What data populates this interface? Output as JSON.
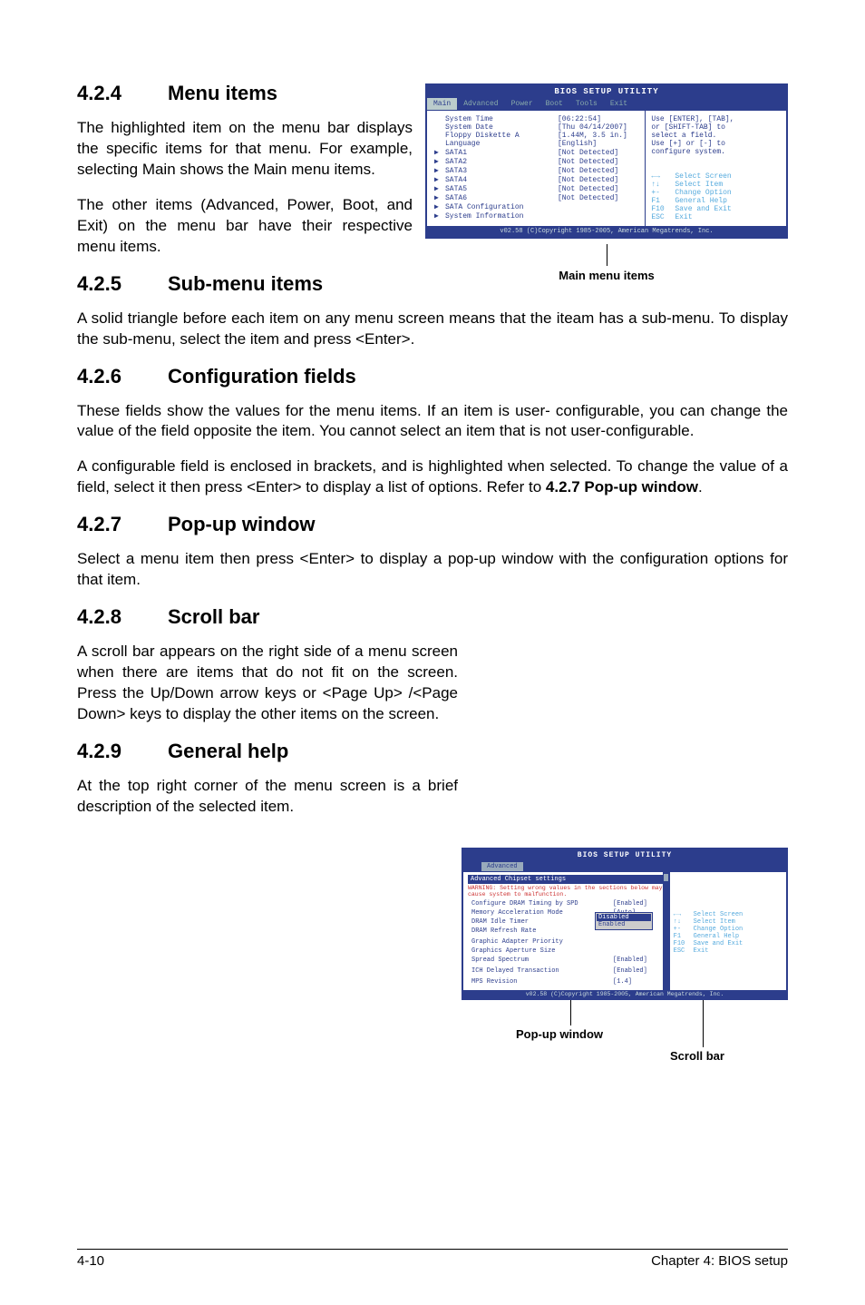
{
  "sections": {
    "s424": {
      "num": "4.2.4",
      "title": "Menu items",
      "p1": "The highlighted item on the menu bar displays the specific items for that menu. For example, selecting Main shows the Main menu items.",
      "p2": "The other items (Advanced, Power, Boot, and Exit) on the menu bar have their respective menu items."
    },
    "s425": {
      "num": "4.2.5",
      "title": "Sub-menu items",
      "p1": "A solid triangle before each item on any menu screen means that the iteam has a sub-menu. To display the sub-menu, select the item and press <Enter>."
    },
    "s426": {
      "num": "4.2.6",
      "title": "Configuration fields",
      "p1": "These fields show the values for the menu items. If an item is user- configurable, you can change the value of the field opposite the item. You cannot select an item that is not user-configurable.",
      "p2": "A configurable field is enclosed in brackets, and is highlighted when selected. To change the value of a field, select it then press <Enter> to display a list of options. Refer to ",
      "bold": "4.2.7 Pop-up window",
      "p2b": "."
    },
    "s427": {
      "num": "4.2.7",
      "title": "Pop-up window",
      "p1": "Select a menu item then press <Enter> to display a pop-up window with the configuration options for that item."
    },
    "s428": {
      "num": "4.2.8",
      "title": "Scroll bar",
      "p1": "A scroll bar appears on the right side of a menu screen when there are items that do not fit on the screen. Press the Up/Down arrow keys or <Page Up> /<Page Down> keys to display the other items on the screen."
    },
    "s429": {
      "num": "4.2.9",
      "title": "General help",
      "p1": "At the top right corner of the menu screen is a brief description of the selected item."
    }
  },
  "fig1": {
    "setup_title": "BIOS SETUP UTILITY",
    "tabs": [
      "Main",
      "Advanced",
      "Power",
      "Boot",
      "Tools",
      "Exit"
    ],
    "rows": [
      [
        "",
        "System Time",
        "[06:22:54]"
      ],
      [
        "",
        "System Date",
        "[Thu 04/14/2007]"
      ],
      [
        "",
        "Floppy Diskette A",
        "[1.44M, 3.5 in.]"
      ],
      [
        "",
        "Language",
        "[English]"
      ],
      [
        "",
        "",
        ""
      ],
      [
        "▶",
        "SATA1",
        "[Not Detected]"
      ],
      [
        "▶",
        "SATA2",
        "[Not Detected]"
      ],
      [
        "▶",
        "SATA3",
        "[Not Detected]"
      ],
      [
        "▶",
        "SATA4",
        "[Not Detected]"
      ],
      [
        "▶",
        "SATA5",
        "[Not Detected]"
      ],
      [
        "▶",
        "SATA6",
        "[Not Detected]"
      ],
      [
        "",
        "",
        ""
      ],
      [
        "▶",
        "SATA Configuration",
        ""
      ],
      [
        "▶",
        "System Information",
        ""
      ]
    ],
    "help": [
      "Use [ENTER], [TAB],",
      "or [SHIFT-TAB] to",
      "select a field.",
      "",
      "Use [+] or [-] to",
      "configure system."
    ],
    "nav": [
      [
        "←→",
        "Select Screen"
      ],
      [
        "↑↓",
        "Select Item"
      ],
      [
        "+-",
        "Change Option"
      ],
      [
        "F1",
        "General Help"
      ],
      [
        "F10",
        "Save and Exit"
      ],
      [
        "ESC",
        "Exit"
      ]
    ],
    "footer": "v02.58 (C)Copyright 1985-2005, American Megatrends, Inc.",
    "caption": "Main menu items"
  },
  "fig2": {
    "setup_title": "BIOS SETUP UTILITY",
    "tab": "Advanced",
    "header": "Advanced Chipset settings",
    "warn": "WARNING: Setting wrong values in the sections below may cause system to malfunction.",
    "rows": [
      [
        "Configure DRAM Timing by SPD",
        "[Enabled]"
      ],
      [
        "Memory Acceleration Mode",
        "[Auto]"
      ],
      [
        "DRAM Idle Timer",
        ""
      ],
      [
        "DRAM Refresh Rate",
        ""
      ],
      [
        "",
        ""
      ],
      [
        "Graphic Adapter Priority",
        ""
      ],
      [
        "Graphics Aperture Size",
        ""
      ],
      [
        "Spread Spectrum",
        "[Enabled]"
      ],
      [
        "",
        ""
      ],
      [
        "ICH Delayed Transaction",
        "[Enabled]"
      ],
      [
        "",
        ""
      ],
      [
        "MPS Revision",
        "[1.4]"
      ]
    ],
    "popup": {
      "options": [
        "Disabled",
        "Enabled"
      ],
      "selected": 0
    },
    "nav": [
      [
        "←→",
        "Select Screen"
      ],
      [
        "↑↓",
        "Select Item"
      ],
      [
        "+-",
        "Change Option"
      ],
      [
        "F1",
        "General Help"
      ],
      [
        "F10",
        "Save and Exit"
      ],
      [
        "ESC",
        "Exit"
      ]
    ],
    "footer": "v02.58 (C)Copyright 1985-2005, American Megatrends, Inc.",
    "caption_popup": "Pop-up window",
    "caption_scroll": "Scroll bar"
  },
  "page_footer": {
    "page": "4-10",
    "chapter": "Chapter 4: BIOS setup"
  }
}
